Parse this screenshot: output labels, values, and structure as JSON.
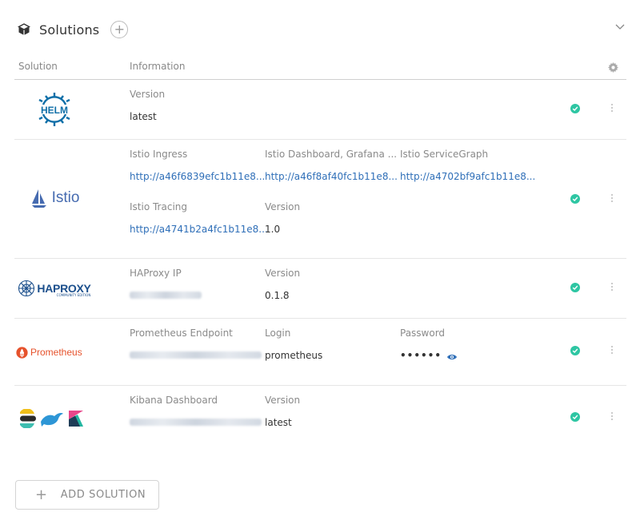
{
  "header": {
    "title": "Solutions",
    "add_icon": "plus-circle-icon",
    "collapse_icon": "chevron-down-icon"
  },
  "table": {
    "col_solution": "Solution",
    "col_information": "Information",
    "settings_icon": "gear-icon"
  },
  "rows": [
    {
      "name": "HELM",
      "logo": "helm-logo",
      "fields": [
        {
          "label": "Version",
          "value": "latest"
        }
      ],
      "status": "ready"
    },
    {
      "name": "Istio",
      "logo": "istio-logo",
      "fields": [
        {
          "label": "Istio Ingress",
          "value": "http://a46f6839efc1b11e8..."
        },
        {
          "label": "Istio Dashboard, Grafana ...",
          "value": "http://a46f8af40fc1b11e8..."
        },
        {
          "label": "Istio ServiceGraph",
          "value": "http://a4702bf9afc1b11e8..."
        },
        {
          "label": "Istio Tracing",
          "value": "http://a4741b2a4fc1b11e8..."
        },
        {
          "label": "Version",
          "value": "1.0"
        }
      ],
      "status": "ready"
    },
    {
      "name": "HAPROXY",
      "subtitle": "COMMUNITY EDITION",
      "logo": "haproxy-logo",
      "fields": [
        {
          "label": "HAProxy IP",
          "value": ""
        },
        {
          "label": "Version",
          "value": "0.1.8"
        }
      ],
      "status": "ready"
    },
    {
      "name": "Prometheus",
      "logo": "prometheus-logo",
      "fields": [
        {
          "label": "Prometheus Endpoint",
          "value": ""
        },
        {
          "label": "Login",
          "value": "prometheus"
        },
        {
          "label": "Password",
          "value": "••••••"
        }
      ],
      "status": "ready"
    },
    {
      "name": "EFK",
      "logo": "elastic-fluentd-kibana-logos",
      "fields": [
        {
          "label": "Kibana Dashboard",
          "value": ""
        },
        {
          "label": "Version",
          "value": "latest"
        }
      ],
      "status": "ready"
    }
  ],
  "add_button": {
    "label": "ADD SOLUTION"
  },
  "colors": {
    "link": "#2f6fb8",
    "status_ok": "#2ec6a3",
    "helm": "#0f6fa8",
    "istio": "#466bb0",
    "prometheus": "#e6522c",
    "haproxy": "#1b4f8c"
  }
}
